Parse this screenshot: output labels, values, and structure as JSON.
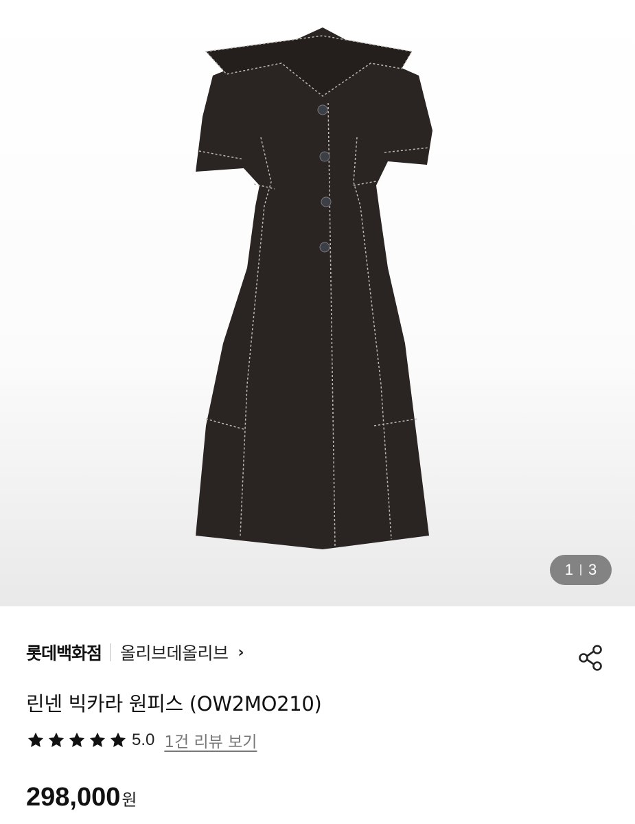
{
  "gallery": {
    "current": "1",
    "total": "3",
    "image_icon": "dress-product-image"
  },
  "product": {
    "store": "롯데백화점",
    "brand": "올리브데올리브",
    "brand_chevron": "›",
    "title": "린넨 빅카라 원피스 (OW2MO210)",
    "rating": {
      "stars": 5,
      "score": "5.0",
      "reviews_link": "1건 리뷰 보기"
    },
    "price": "298,000",
    "currency": "원"
  },
  "colors": {
    "dress": "#2a2422",
    "stitch": "#bfbab4",
    "pager_bg": "#5a5a5a",
    "star": "#111111"
  }
}
